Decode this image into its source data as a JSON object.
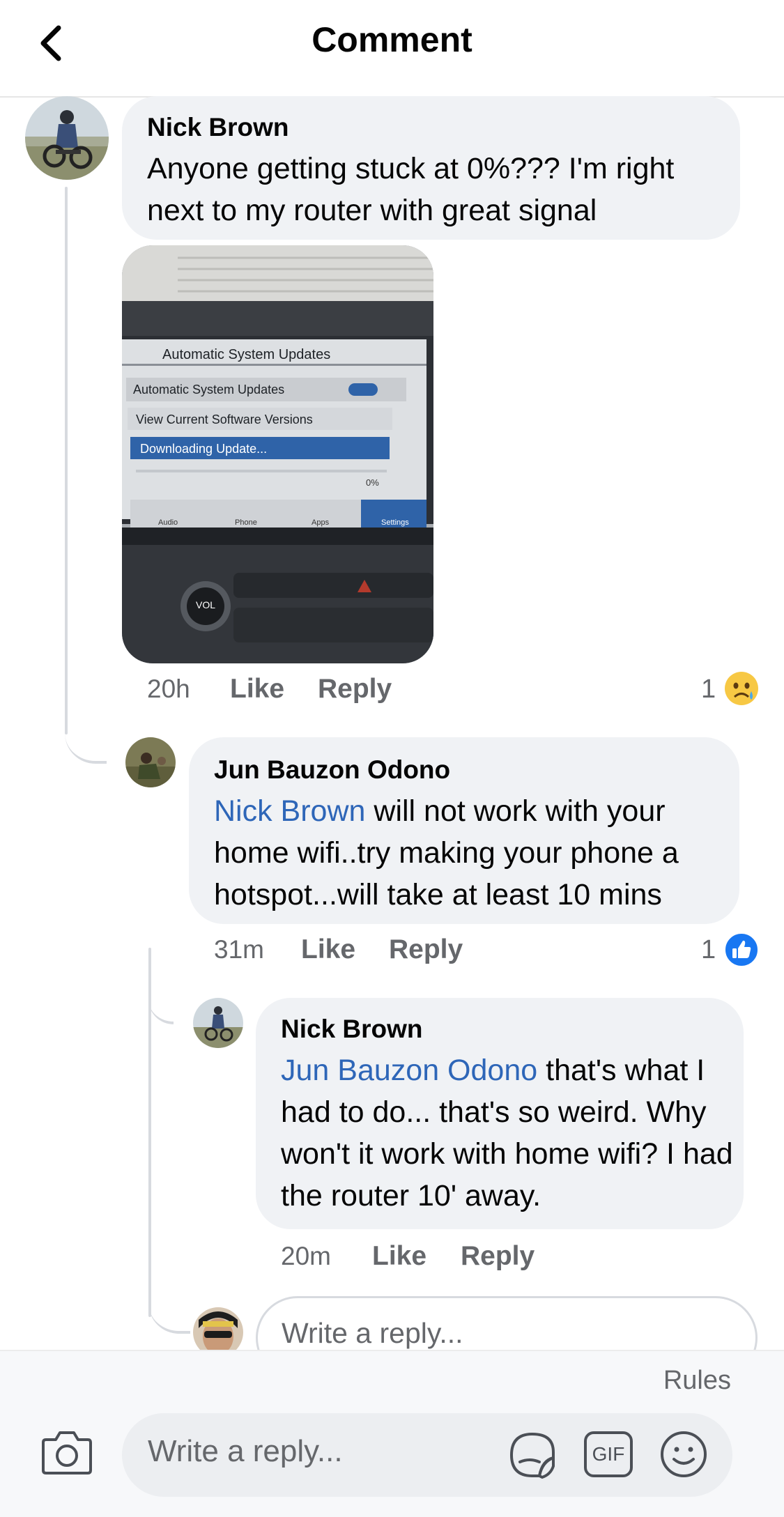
{
  "header": {
    "title": "Comment",
    "back_icon": "chevron-left-icon"
  },
  "comments": [
    {
      "author": "Nick Brown",
      "text": "Anyone getting stuck at 0%??? I'm right next to my router with great signal",
      "time": "20h",
      "like_label": "Like",
      "reply_label": "Reply",
      "reaction_count": "1",
      "reaction_icon": "sad-emoji-icon",
      "photo": {
        "screen_title": "Automatic System Updates",
        "row1": "Automatic System Updates",
        "row2": "View Current Software Versions",
        "row3": "Downloading Update...",
        "progress": "0%",
        "tabs": [
          "Audio",
          "Phone",
          "Apps",
          "Settings"
        ],
        "knob_label": "VOL"
      }
    },
    {
      "author": "Jun Bauzon Odono",
      "mention": "Nick Brown",
      "text": " will not work with your home wifi..try making your phone a hotspot...will take at least 10 mins",
      "time": "31m",
      "like_label": "Like",
      "reply_label": "Reply",
      "reaction_count": "1",
      "reaction_icon": "like-thumb-icon"
    },
    {
      "author": "Nick Brown",
      "mention": "Jun Bauzon Odono",
      "text": " that's what I had to do... that's so weird. Why won't it work with home wifi? I had the router 10' away.",
      "time": "20m",
      "like_label": "Like",
      "reply_label": "Reply"
    }
  ],
  "inline_reply": {
    "placeholder": "Write a reply..."
  },
  "composer": {
    "rules_label": "Rules",
    "placeholder": "Write a reply...",
    "gif_label": "GIF",
    "icons": [
      "camera-icon",
      "sticker-icon",
      "gif-icon",
      "emoji-icon"
    ]
  },
  "colors": {
    "link": "#2e66b8",
    "bubble": "#f0f2f5",
    "like_blue": "#1877f2",
    "muted": "#65676b"
  }
}
